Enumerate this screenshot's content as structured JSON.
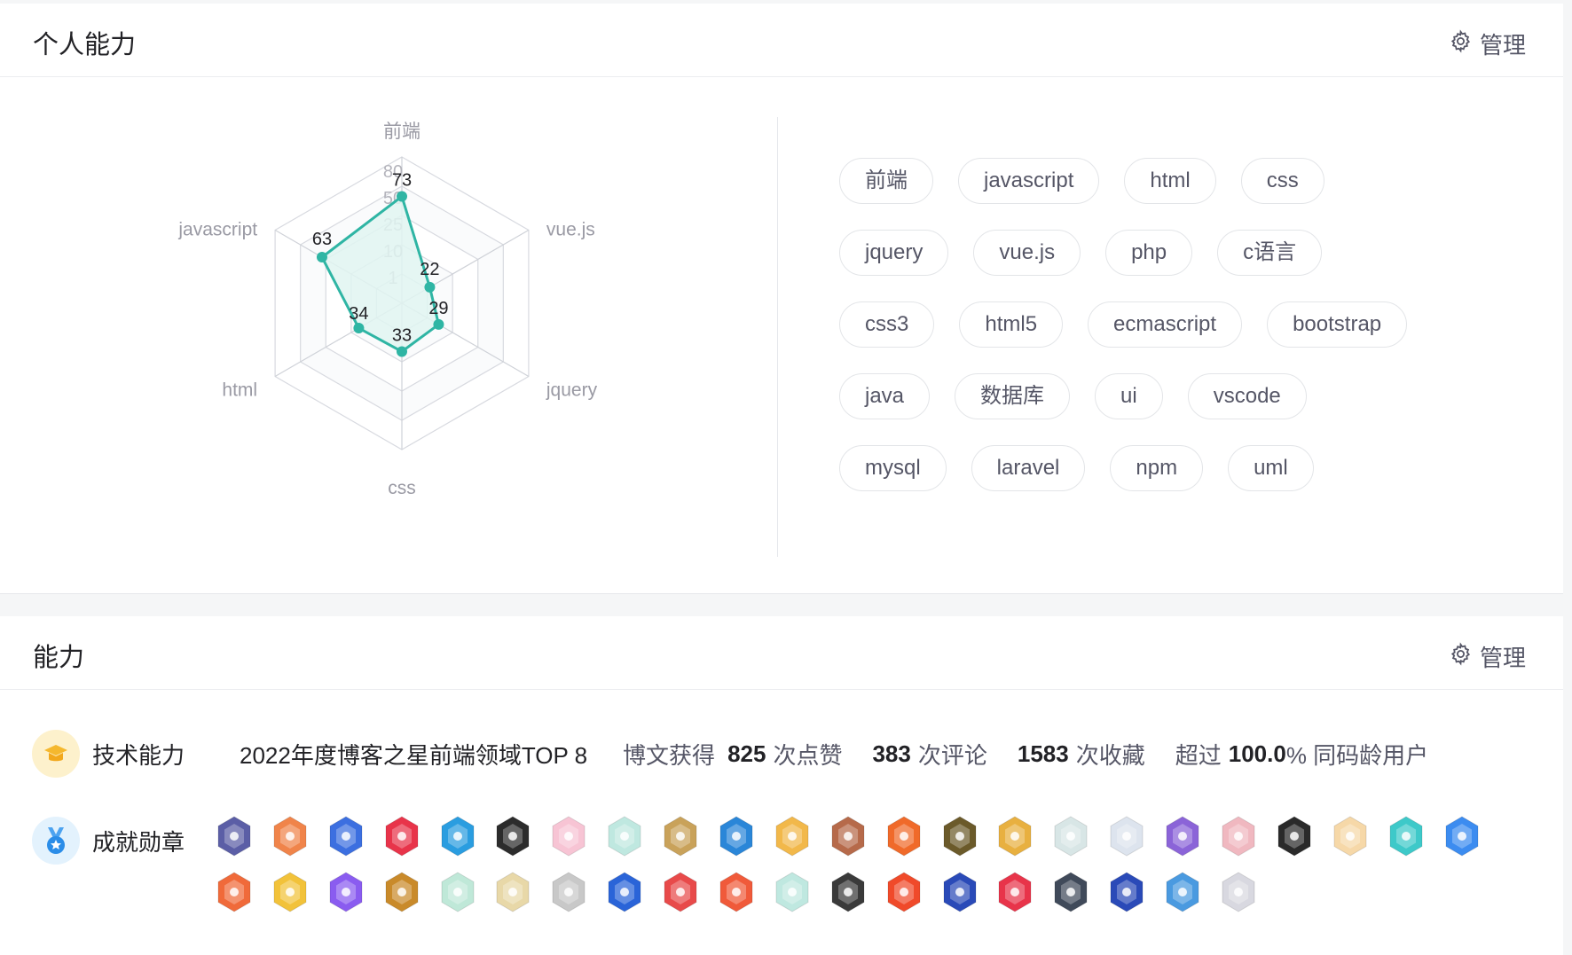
{
  "profile_skills": {
    "title": "个人能力",
    "manage_label": "管理",
    "radar": {
      "axes": [
        "前端",
        "vue.js",
        "jquery",
        "css",
        "html",
        "javascript"
      ],
      "values": [
        73,
        22,
        29,
        33,
        34,
        63
      ],
      "scale_ticks": [
        "1",
        "10",
        "25",
        "50",
        "80"
      ],
      "max": 100,
      "line_color": "#2fb5a4",
      "fill_color": "#e1f4f1"
    },
    "tags": [
      [
        "前端",
        "javascript",
        "html",
        "css"
      ],
      [
        "jquery",
        "vue.js",
        "php",
        "c语言"
      ],
      [
        "css3",
        "html5",
        "ecmascript",
        "bootstrap"
      ],
      [
        "java",
        "数据库",
        "ui",
        "vscode"
      ],
      [
        "mysql",
        "laravel",
        "npm",
        "uml"
      ]
    ]
  },
  "ability": {
    "title": "能力",
    "manage_label": "管理",
    "tech": {
      "label": "技术能力",
      "headline": "2022年度博客之星前端领域TOP 8",
      "stat_prefix": "博文获得",
      "likes": "825",
      "likes_unit": "次点赞",
      "comments": "383",
      "comments_unit": "次评论",
      "favorites": "1583",
      "favorites_unit": "次收藏",
      "exceed_prefix": "超过",
      "exceed_value": "100.0",
      "exceed_suffix": "% 同码龄用户"
    },
    "medals": {
      "label": "成就勋章",
      "badge_colors": [
        [
          "#5b5ea6",
          "#f0844a",
          "#3c6fe0",
          "#e8344a",
          "#2a9de0",
          "#2c2c2c",
          "#f7c4d4",
          "#bfe8e0",
          "#c9a25a",
          "#2a86d8",
          "#f2b84a",
          "#b66a4a",
          "#f06a2a",
          "#6b5a2a",
          "#e8b040",
          "#d8e6e6",
          "#dde4ee",
          "#8b64d8",
          "#f0b8c0",
          "#2a2a2a",
          "#f6d8a8",
          "#3ec9c9",
          "#3c8cf0"
        ],
        [
          "#f06a3a",
          "#f2c23a",
          "#8a5cf0",
          "#c98a2a",
          "#bfe8d8",
          "#e8d8a8",
          "#c8c8c8",
          "#2a64d8",
          "#e84a4a",
          "#f05a3a",
          "#bfe8e0",
          "#3a3a3a",
          "#f04a2a",
          "#2a4ab8",
          "#e8344a",
          "#404a5a",
          "#2a4ab8",
          "#4a9ae0",
          "#d8d8e0"
        ]
      ]
    }
  }
}
